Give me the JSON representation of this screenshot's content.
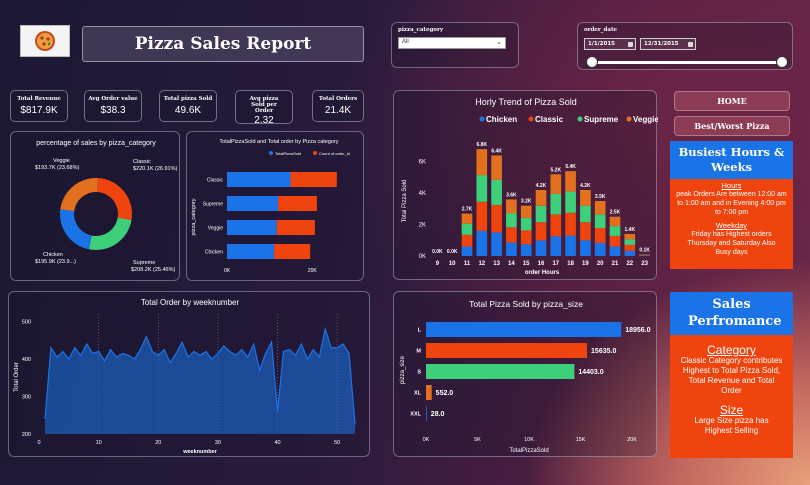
{
  "header": {
    "title": "Pizza Sales Report",
    "logo_icon": "pizza-logo-icon"
  },
  "filters": {
    "category_label": "pizza_category",
    "category_value": "All",
    "date_label": "order_date",
    "date_start": "1/1/2015",
    "date_end": "12/31/2015"
  },
  "kpis": [
    {
      "label": "Total Revenue",
      "value": "$817.9K"
    },
    {
      "label": "Avg Order value",
      "value": "$38.3"
    },
    {
      "label": "Total pizza Sold",
      "value": "49.6K"
    },
    {
      "label": "Avg pizza Sold per Order",
      "value": "2.32"
    },
    {
      "label": "Total Orders",
      "value": "21.4K"
    }
  ],
  "nav": {
    "home": "HOME",
    "best_worst": "Best/Worst Pizza"
  },
  "busiest": {
    "title": "Busiest Hours & Weeks",
    "hours_head": "Hours",
    "hours_text": "peak Orders Are between 12:00 am to 1:00 am and in Evening 4:00 pm to 7:00 pm",
    "weekday_head": "Weekday",
    "weekday_text": "Friday has Highest orders Thursday and Saturday Also Busy days"
  },
  "performance": {
    "title": "Sales Perfromance",
    "category_head": "Category",
    "category_text": "Classic Category contributes Highest to Total Pizza Sold, Total Revenue and Total Order",
    "size_head": "Size",
    "size_text": "Large Size pizza has Highest Selling"
  },
  "chart_data": [
    {
      "id": "donut",
      "type": "pie",
      "title": "percentage of sales by pizza_category",
      "categories": [
        "Classic",
        "Supreme",
        "Chicken",
        "Veggie"
      ],
      "values": [
        26.91,
        25.46,
        23.96,
        23.68
      ],
      "labels": [
        "Classic\n$220.1K (26.91%)",
        "Supreme\n$208.2K (25.46%)",
        "Chicken\n$195.9K (23.9...)",
        "Veggie\n$193.7K (23.68%)"
      ],
      "colors": [
        "#f0440e",
        "#3ecf7b",
        "#1a74e8",
        "#e3701f"
      ]
    },
    {
      "id": "catbar",
      "type": "bar",
      "title": "TotalPizzaSold and Total order by Pizza category",
      "ylabel": "pizza_category",
      "categories": [
        "Classic",
        "Supreme",
        "Veggie",
        "Chicken"
      ],
      "series": [
        {
          "name": "TotalPizzaSold",
          "values": [
            14888,
            11987,
            11649,
            11050
          ],
          "color": "#1a74e8"
        },
        {
          "name": "Count of order_id",
          "values": [
            10859,
            9085,
            8941,
            8443
          ],
          "color": "#f0440e"
        }
      ],
      "xticks": [
        "0K",
        "20K"
      ],
      "xlim": [
        0,
        30000
      ]
    },
    {
      "id": "hourly",
      "type": "bar",
      "title": "Horly Trend of Pizza Sold",
      "xlabel": "order Hours",
      "ylabel": "Total Pizza Sold",
      "categories": [
        "9",
        "10",
        "11",
        "12",
        "13",
        "14",
        "15",
        "16",
        "17",
        "18",
        "19",
        "20",
        "21",
        "22",
        "23"
      ],
      "totals_labels": [
        "0.0K",
        "0.0K",
        "2.7K",
        "6.8K",
        "6.4K",
        "3.6K",
        "3.2K",
        "4.2K",
        "5.2K",
        "5.4K",
        "4.2K",
        "3.5K",
        "2.5K",
        "1.4K",
        "0.1K"
      ],
      "series": [
        {
          "name": "Chicken",
          "color": "#1a74e8",
          "values": [
            0,
            0,
            600,
            1600,
            1500,
            850,
            750,
            1000,
            1250,
            1300,
            1000,
            830,
            600,
            330,
            25
          ]
        },
        {
          "name": "Classic",
          "color": "#f0440e",
          "values": [
            0,
            0,
            750,
            1850,
            1750,
            980,
            880,
            1150,
            1400,
            1450,
            1150,
            950,
            680,
            380,
            30
          ]
        },
        {
          "name": "Supreme",
          "color": "#3ecf7b",
          "values": [
            0,
            0,
            700,
            1700,
            1600,
            900,
            800,
            1050,
            1300,
            1350,
            1050,
            870,
            620,
            350,
            25
          ]
        },
        {
          "name": "Veggie",
          "color": "#e3701f",
          "values": [
            0,
            0,
            650,
            1650,
            1550,
            870,
            770,
            1000,
            1250,
            1300,
            1000,
            850,
            600,
            340,
            20
          ]
        }
      ],
      "yticks": [
        "0K",
        "2K",
        "4K",
        "6K"
      ],
      "ylim": [
        0,
        7000
      ]
    },
    {
      "id": "weekly",
      "type": "area",
      "title": "Total Order by weeknumber",
      "xlabel": "weeknumber",
      "ylabel": "Total Order",
      "x": [
        1,
        2,
        3,
        4,
        5,
        6,
        7,
        8,
        9,
        10,
        11,
        12,
        13,
        14,
        15,
        16,
        17,
        18,
        19,
        20,
        21,
        22,
        23,
        24,
        25,
        26,
        27,
        28,
        29,
        30,
        31,
        32,
        33,
        34,
        35,
        36,
        37,
        38,
        39,
        40,
        41,
        42,
        43,
        44,
        45,
        46,
        47,
        48,
        49,
        50,
        51,
        52,
        53
      ],
      "values": [
        240,
        430,
        405,
        420,
        400,
        430,
        410,
        440,
        415,
        420,
        395,
        425,
        405,
        415,
        410,
        400,
        425,
        460,
        420,
        410,
        425,
        390,
        415,
        445,
        405,
        420,
        410,
        420,
        400,
        415,
        435,
        420,
        410,
        425,
        405,
        440,
        370,
        415,
        445,
        260,
        420,
        425,
        410,
        440,
        400,
        425,
        405,
        480,
        430,
        430,
        440,
        415,
        225
      ],
      "xticks": [
        0,
        10,
        20,
        30,
        40,
        50
      ],
      "yticks": [
        200,
        300,
        400,
        500
      ],
      "ylim": [
        200,
        520
      ],
      "xlim": [
        0,
        54
      ],
      "color": "#1a74e8"
    },
    {
      "id": "size",
      "type": "bar",
      "title": "Total Pizza Sold by pizza_size",
      "xlabel": "TotalPizzaSold",
      "ylabel": "pizza_size",
      "categories": [
        "L",
        "M",
        "S",
        "XL",
        "XXL"
      ],
      "values": [
        18956.0,
        15635.0,
        14403.0,
        552.0,
        28.0
      ],
      "value_labels": [
        "18956.0",
        "15635.0",
        "14403.0",
        "552.0",
        "28.0"
      ],
      "colors": [
        "#1a74e8",
        "#f0440e",
        "#3ecf7b",
        "#e3701f",
        "#1a74e8"
      ],
      "xticks": [
        "0K",
        "5K",
        "10K",
        "15K",
        "20K"
      ],
      "xlim": [
        0,
        20000
      ]
    }
  ]
}
